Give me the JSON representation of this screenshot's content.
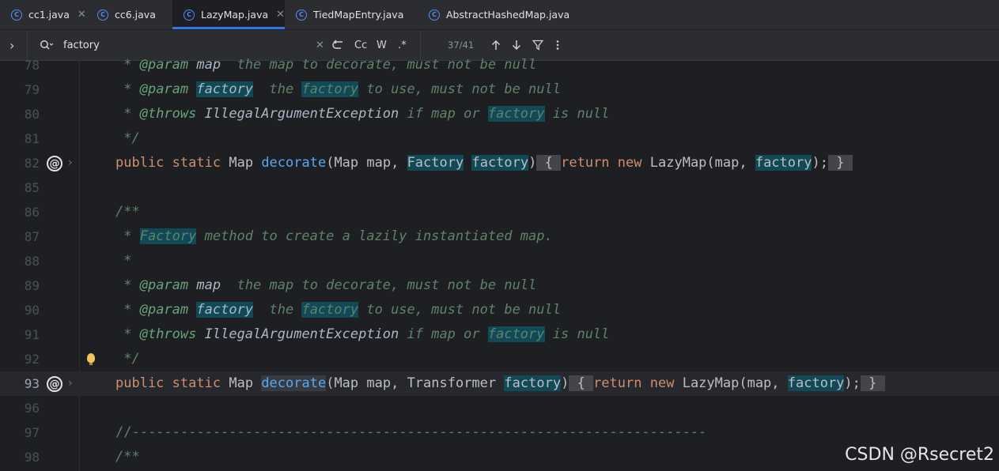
{
  "tabs": [
    {
      "label": "cc1.java",
      "closable": true
    },
    {
      "label": "cc6.java",
      "closable": false
    },
    {
      "label": "LazyMap.java",
      "closable": true,
      "active": true
    },
    {
      "label": "TiedMapEntry.java",
      "closable": false
    },
    {
      "label": "AbstractHashedMap.java",
      "closable": false
    }
  ],
  "search": {
    "expand_glyph": "›",
    "query": "factory",
    "match_count": "37/41",
    "match_case": "Cc",
    "whole_words": "W",
    "regex": ".*",
    "icons": [
      "search-history-icon",
      "clear-icon",
      "replace-toggle-icon",
      "prev-occurrence-icon",
      "next-occurrence-icon",
      "filter-icon",
      "more-icon"
    ]
  },
  "editor": {
    "line_numbers": [
      "78",
      "79",
      "80",
      "81",
      "82",
      "85",
      "86",
      "87",
      "88",
      "89",
      "90",
      "91",
      "92",
      "93",
      "96",
      "97",
      "98"
    ],
    "current_line": "93",
    "code_pieces": {
      "star": " * ",
      "param": "@param",
      "throws": "@throws",
      "map": "map",
      "the_map": "  the map to decorate, must not be null",
      "factory": "factory",
      "the": "  the ",
      "to_use": " to use, must not be null",
      "iae": "IllegalArgumentException",
      "if_map_or": " if map or ",
      "is_null": " is null",
      "close": " */",
      "open": "/**",
      "lone_star": " *",
      "Factory": "Factory",
      "method_desc": " method to create a lazily instantiated map.",
      "public": "public",
      "static": "static",
      "Map": "Map",
      "decorate": "decorate",
      "lp_map_map": "(Map map, ",
      "Transformer": "Transformer",
      "rp": ")",
      "lbrace": "{",
      "return": "return",
      "new": "new",
      "LazyMap_map": "LazyMap(map, ",
      "semi": ");",
      "rbrace": "}",
      "rule": "//-----------------------------------------------------------------------"
    }
  },
  "watermark": "CSDN @Rsecret2"
}
